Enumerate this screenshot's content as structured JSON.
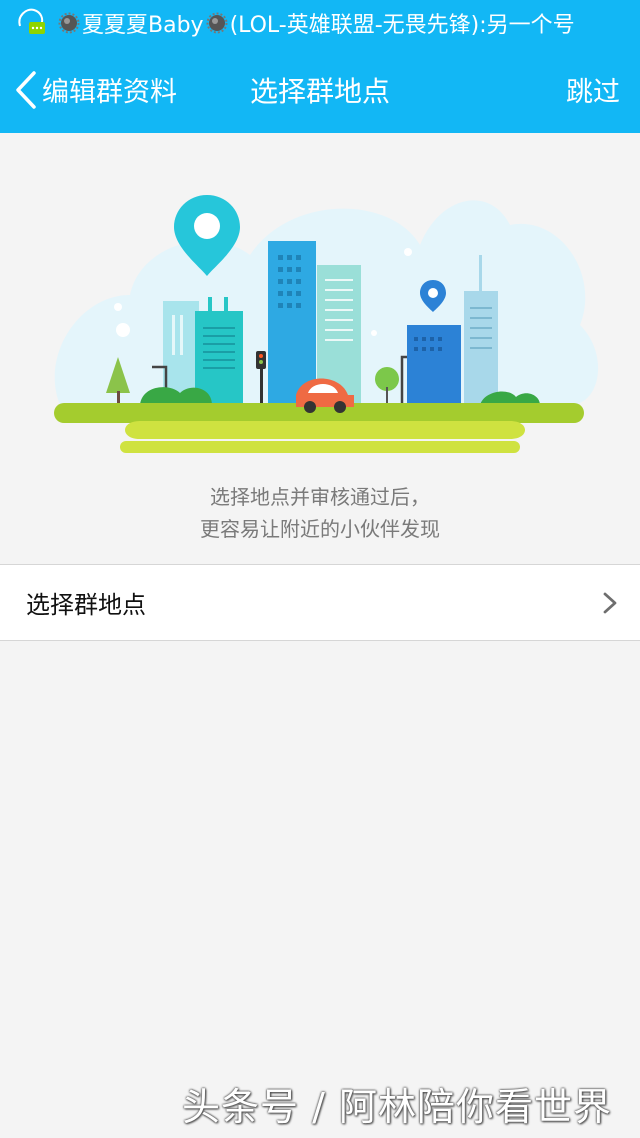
{
  "status_bar": {
    "notification_text": "夏夏夏Baby",
    "notification_detail": "(LOL-英雄联盟-无畏先锋):另一个号",
    "app_icon": "qq-chat-icon",
    "decoration_icon": "gear-icon"
  },
  "nav": {
    "back_label": "编辑群资料",
    "title": "选择群地点",
    "skip_label": "跳过"
  },
  "hint": {
    "line1": "选择地点并审核通过后，",
    "line2": "更容易让附近的小伙伴发现"
  },
  "location_row": {
    "label": "选择群地点",
    "icon": "chevron-right-icon"
  },
  "watermark": "头条号 / 阿林陪你看世界",
  "colors": {
    "accent": "#12b7f5",
    "background": "#f4f4f4",
    "hint_text": "#7a7a7a"
  }
}
